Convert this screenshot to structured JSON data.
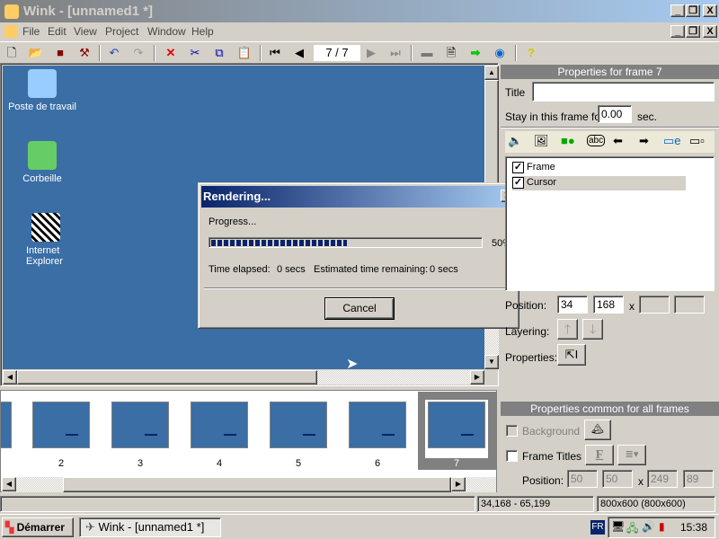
{
  "window": {
    "title": "Wink - [unnamed1 *]"
  },
  "menu": [
    "File",
    "Edit",
    "View",
    "Project",
    "Window",
    "Help"
  ],
  "toolbar": {
    "frame_counter": "7 / 7",
    "icons": [
      "new-icon",
      "open-icon",
      "save-icon",
      "build-icon",
      "undo-icon",
      "redo-icon",
      "delete-icon",
      "cut-icon",
      "copy-icon",
      "paste-icon",
      "first-frame-icon",
      "prev-frame-icon",
      "next-frame-icon",
      "last-frame-icon",
      "render-icon",
      "page-icon",
      "export-arrow-icon",
      "browser-icon",
      "help-icon"
    ]
  },
  "desktop": {
    "icons": [
      "Poste de travail",
      "Corbeille",
      "Internet\nExplorer"
    ],
    "color": "#3a6ea5"
  },
  "dialog": {
    "title": "Rendering...",
    "progress_label": "Progress...",
    "progress_percent": 50,
    "percent_text": "50%",
    "time_elapsed_label": "Time elapsed:",
    "time_elapsed": "0 secs",
    "remaining_label": "Estimated time remaining:",
    "remaining": "0 secs",
    "cancel": "Cancel"
  },
  "frame_props": {
    "header": "Properties for frame 7",
    "title_label": "Title",
    "title_value": "",
    "stay_label": "Stay in this frame for",
    "stay_value": "0.00",
    "stay_unit": "sec.",
    "layers": [
      {
        "label": "Frame",
        "checked": true
      },
      {
        "label": "Cursor",
        "checked": true
      }
    ],
    "position_label": "Position:",
    "pos_x": "34",
    "pos_y": "168",
    "pos_sep": "x",
    "pos_w": "",
    "pos_h": "",
    "layering_label": "Layering:",
    "properties_label": "Properties:"
  },
  "common_props": {
    "header": "Properties common for all frames",
    "background_label": "Background",
    "background_checked": false,
    "frame_titles_label": "Frame Titles",
    "frame_titles_checked": false,
    "position_label": "Position:",
    "x": "50",
    "y": "50",
    "sep": "x",
    "w": "249",
    "h": "89"
  },
  "thumbnails": {
    "frames": [
      "2",
      "3",
      "4",
      "5",
      "6",
      "7"
    ],
    "selected": "7"
  },
  "status": {
    "left": "",
    "coords": "34,168 - 65,199",
    "size": "800x600 (800x600)"
  },
  "taskbar": {
    "start": "Démarrer",
    "task": "Wink - [unnamed1 *]",
    "lang": "FR",
    "clock": "15:38"
  }
}
